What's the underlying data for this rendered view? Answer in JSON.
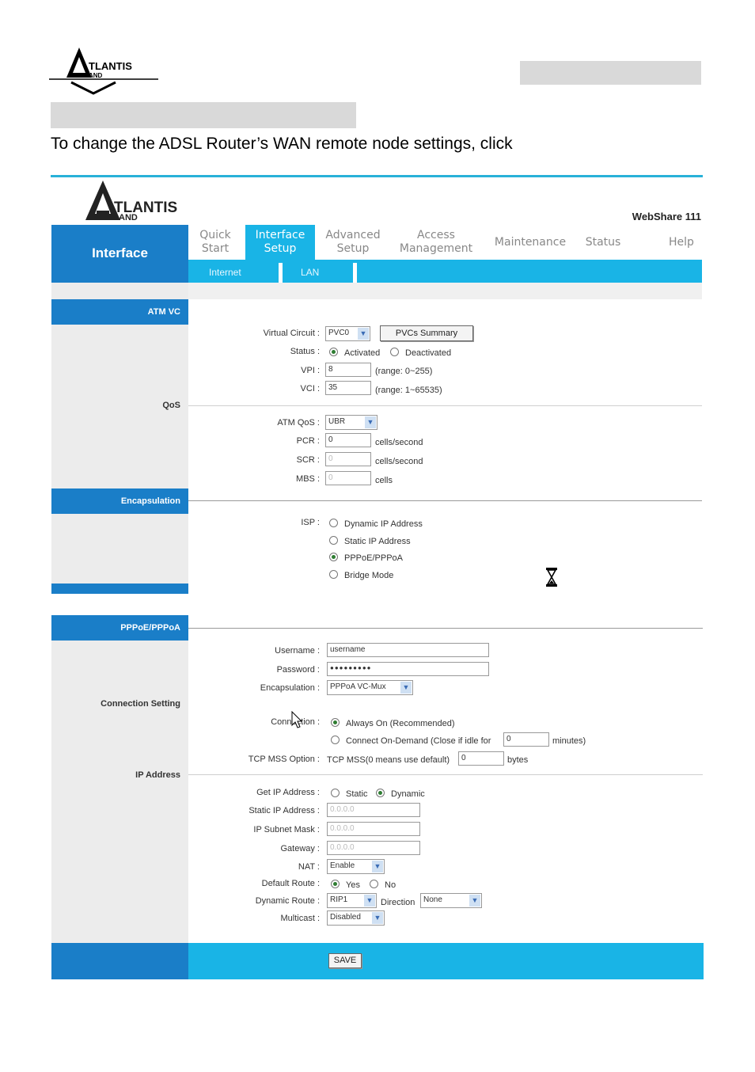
{
  "doc": {
    "intro": "To change the ADSL Router’s WAN remote node settings, click"
  },
  "header": {
    "brand": "TLANTIS",
    "brand_sub": "AND",
    "product": "WebShare 111"
  },
  "nav": {
    "section": "Interface",
    "items": [
      {
        "line1": "Quick",
        "line2": "Start"
      },
      {
        "line1": "Interface",
        "line2": "Setup"
      },
      {
        "line1": "Advanced",
        "line2": "Setup"
      },
      {
        "line1": "Access",
        "line2": "Management"
      },
      {
        "line1": "Maintenance",
        "line2": ""
      },
      {
        "line1": "Status",
        "line2": ""
      },
      {
        "line1": "Help",
        "line2": ""
      }
    ],
    "sub": [
      "Internet",
      "LAN"
    ]
  },
  "sections": {
    "atm_vc": "ATM VC",
    "qos": "QoS",
    "encapsulation": "Encapsulation",
    "pppoe": "PPPoE/PPPoA",
    "connection_setting": "Connection Setting",
    "ip_address": "IP Address"
  },
  "atm": {
    "vc_label": "Virtual Circuit :",
    "vc_value": "PVC0",
    "pvc_summary_btn": "PVCs Summary",
    "status_label": "Status :",
    "status_activated": "Activated",
    "status_deactivated": "Deactivated",
    "vpi_label": "VPI :",
    "vpi_value": "8",
    "vpi_range": "(range: 0~255)",
    "vci_label": "VCI :",
    "vci_value": "35",
    "vci_range": "(range: 1~65535)"
  },
  "qos": {
    "atm_qos_label": "ATM QoS :",
    "atm_qos_value": "UBR",
    "pcr_label": "PCR :",
    "pcr_value": "0",
    "scr_label": "SCR :",
    "scr_value": "0",
    "mbs_label": "MBS :",
    "mbs_value": "0",
    "unit_cells_second": "cells/second",
    "unit_cells": "cells"
  },
  "encap": {
    "isp_label": "ISP :",
    "options": [
      "Dynamic IP Address",
      "Static IP Address",
      "PPPoE/PPPoA",
      "Bridge Mode"
    ]
  },
  "pppoe": {
    "username_label": "Username :",
    "username_value": "username",
    "password_label": "Password :",
    "password_value": "●●●●●●●●●",
    "encap_label": "Encapsulation :",
    "encap_value": "PPPoA VC-Mux",
    "connection_label": "Connection :",
    "always_on": "Always On (Recommended)",
    "on_demand": "Connect On-Demand (Close if idle for",
    "idle_value": "0",
    "minutes": "minutes)",
    "tcp_mss_label": "TCP MSS Option :",
    "tcp_mss_text": "TCP MSS(0 means use default)",
    "tcp_mss_value": "0",
    "bytes": "bytes"
  },
  "ip": {
    "get_ip_label": "Get IP Address :",
    "static": "Static",
    "dynamic": "Dynamic",
    "static_ip_label": "Static IP Address :",
    "static_ip_value": "0.0.0.0",
    "subnet_label": "IP Subnet Mask :",
    "subnet_value": "0.0.0.0",
    "gateway_label": "Gateway :",
    "gateway_value": "0.0.0.0",
    "nat_label": "NAT :",
    "nat_value": "Enable",
    "default_route_label": "Default Route :",
    "yes": "Yes",
    "no": "No",
    "dynamic_route_label": "Dynamic Route :",
    "dynamic_route_value": "RIP1",
    "direction_label": "Direction",
    "direction_value": "None",
    "multicast_label": "Multicast :",
    "multicast_value": "Disabled"
  },
  "footer": {
    "save": "SAVE"
  },
  "colors": {
    "brand_blue": "#1a7ec8",
    "accent_cyan": "#19b4e6",
    "doc_gray": "#d9d9d9"
  }
}
